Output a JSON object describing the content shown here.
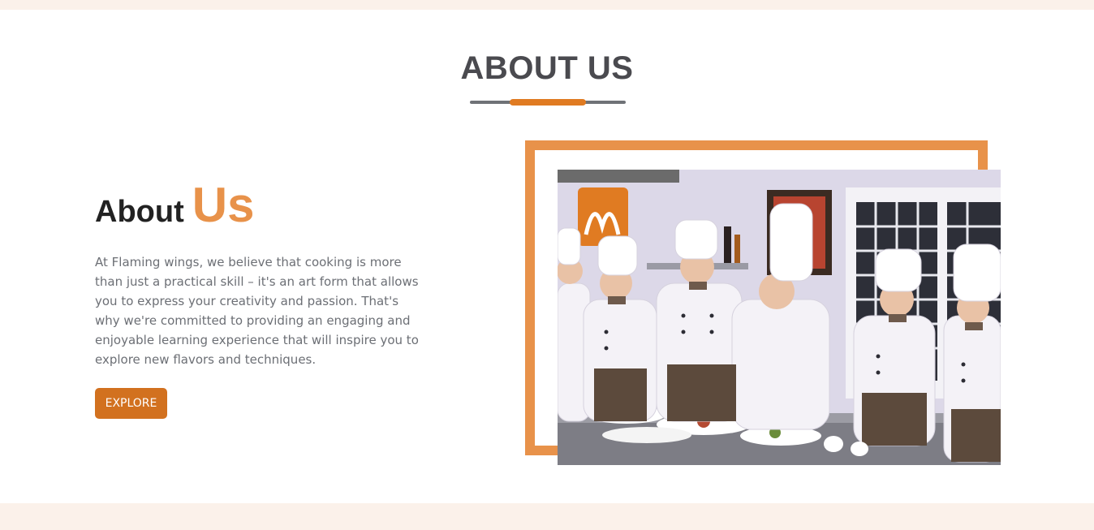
{
  "section": {
    "title": "ABOUT US"
  },
  "about": {
    "heading_word1": "About",
    "heading_word2": "Us",
    "description": "At Flaming wings, we believe that cooking is more than just a practical skill – it's an art form that allows you to express your creativity and passion. That's why we're committed to providing an engaging and enjoyable learning experience that will inspire you to explore new flavors and techniques.",
    "button_label": "EXPLORE"
  },
  "colors": {
    "accent": "#e8924a",
    "button": "#d2711f",
    "title": "#4a4a4f",
    "band": "#fbf1ea"
  },
  "image": {
    "subject": "chefs-cooking-class-photo"
  }
}
